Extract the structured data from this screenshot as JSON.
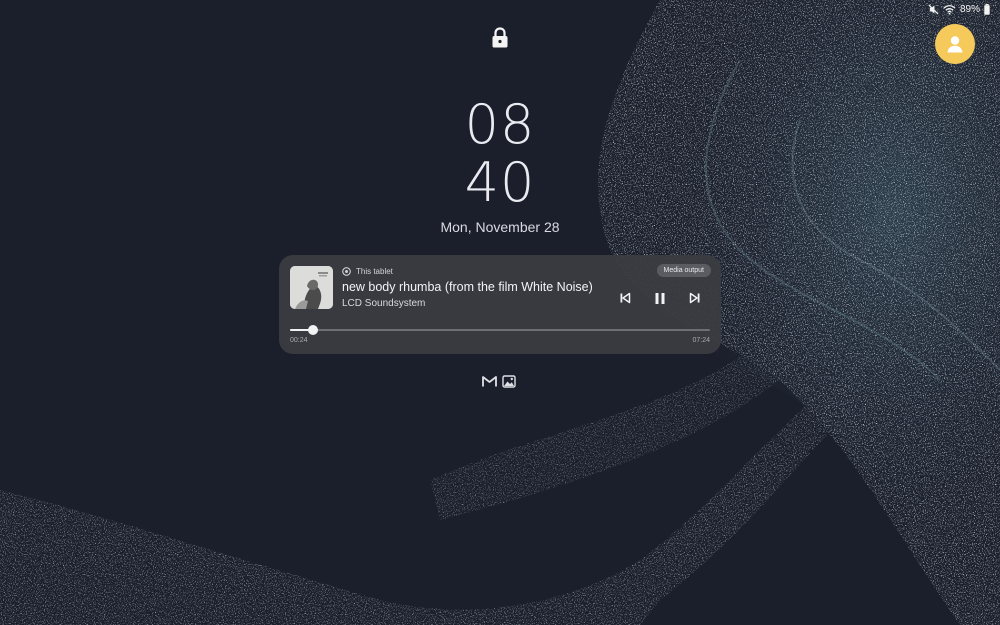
{
  "status_bar": {
    "battery_percent": "89%",
    "icons": [
      "mute-icon",
      "wifi-icon",
      "battery-icon"
    ]
  },
  "lock_screen": {
    "clock_hours": "08",
    "clock_minutes": "40",
    "date": "Mon, November 28"
  },
  "media_player": {
    "source": "This tablet",
    "output_button": "Media output",
    "title": "new body rhumba (from the film White Noise)",
    "artist": "LCD Soundsystem",
    "elapsed": "00:24",
    "duration": "07:24",
    "progress_fraction": 0.054,
    "controls": [
      "previous-icon",
      "pause-icon",
      "next-icon"
    ]
  },
  "notification_icons": [
    "gmail-icon",
    "gallery-icon"
  ],
  "colors": {
    "background": "#1b1f2b",
    "avatar": "#f5c95a",
    "card": "#3a3c42"
  }
}
